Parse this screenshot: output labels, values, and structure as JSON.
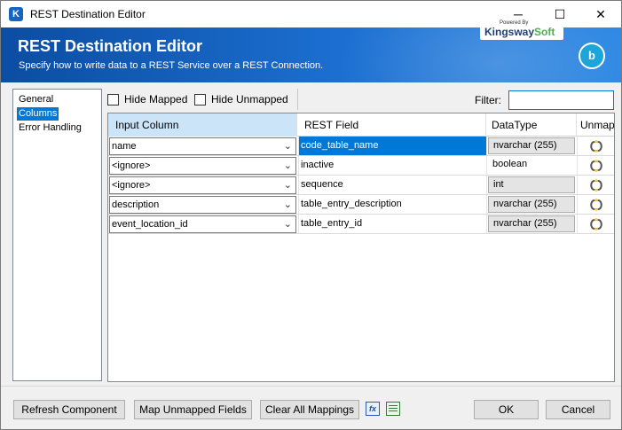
{
  "window": {
    "title": "REST Destination Editor",
    "app_icon_letter": "K",
    "controls": {
      "minimize": "─",
      "maximize": "☐",
      "close": "✕"
    }
  },
  "header": {
    "title": "REST Destination Editor",
    "subtitle": "Specify how to write data to a REST Service over a REST Connection.",
    "brand_powered": "Powered By",
    "brand_name_k": "Kingsway",
    "brand_name_soft": "Soft",
    "logo_letter": "b"
  },
  "nav": {
    "items": [
      {
        "label": "General",
        "selected": false
      },
      {
        "label": "Columns",
        "selected": true
      },
      {
        "label": "Error Handling",
        "selected": false
      }
    ]
  },
  "toolbar": {
    "hide_mapped": "Hide Mapped",
    "hide_unmapped": "Hide Unmapped",
    "filter_label": "Filter:",
    "filter_value": ""
  },
  "grid": {
    "headers": {
      "input": "Input Column",
      "rest": "REST Field",
      "type": "DataType",
      "unmap": "Unmap"
    },
    "rows": [
      {
        "input": "name",
        "rest": "code_table_name",
        "type": "nvarchar (255)",
        "type_boxed": true,
        "selected": true
      },
      {
        "input": "<ignore>",
        "rest": "inactive",
        "type": "boolean",
        "type_boxed": false,
        "selected": false
      },
      {
        "input": "<ignore>",
        "rest": "sequence",
        "type": "int",
        "type_boxed": true,
        "selected": false
      },
      {
        "input": "description",
        "rest": "table_entry_description",
        "type": "nvarchar (255)",
        "type_boxed": true,
        "selected": false
      },
      {
        "input": "event_location_id",
        "rest": "table_entry_id",
        "type": "nvarchar (255)",
        "type_boxed": true,
        "selected": false
      }
    ]
  },
  "footer": {
    "refresh": "Refresh Component",
    "map_unmapped": "Map Unmapped Fields",
    "clear_all": "Clear All Mappings",
    "fx_icon": "fx",
    "ok": "OK",
    "cancel": "Cancel"
  }
}
